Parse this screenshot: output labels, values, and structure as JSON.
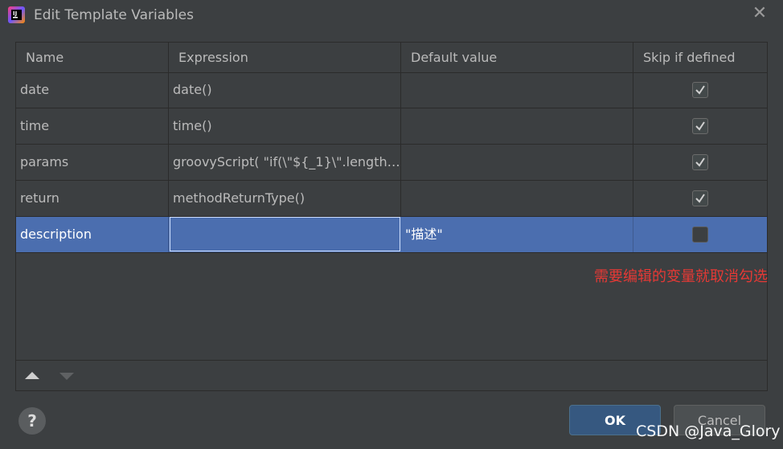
{
  "window": {
    "title": "Edit Template Variables",
    "close_label": "✕"
  },
  "table": {
    "columns": [
      "Name",
      "Expression",
      "Default value",
      "Skip if defined"
    ],
    "rows": [
      {
        "name": "date",
        "expression": "date()",
        "default_value": "",
        "skip_if_defined": true
      },
      {
        "name": "time",
        "expression": "time()",
        "default_value": "",
        "skip_if_defined": true
      },
      {
        "name": "params",
        "expression": "groovyScript( \"if(\\\"${_1}\\\".length…",
        "default_value": "",
        "skip_if_defined": true
      },
      {
        "name": "return",
        "expression": "methodReturnType()",
        "default_value": "",
        "skip_if_defined": true
      },
      {
        "name": "description",
        "expression": "",
        "default_value": "\"描述\"",
        "skip_if_defined": false
      }
    ],
    "selected_row_index": 4
  },
  "annotation": "需要编辑的变量就取消勾选",
  "footer": {
    "help_label": "?",
    "ok_label": "OK",
    "cancel_label": "Cancel"
  },
  "watermark": "CSDN @Java_Glory",
  "colors": {
    "background": "#3c3f41",
    "selection": "#4b6eaf",
    "annotation_red": "#e53935",
    "ok_button": "#365880"
  }
}
